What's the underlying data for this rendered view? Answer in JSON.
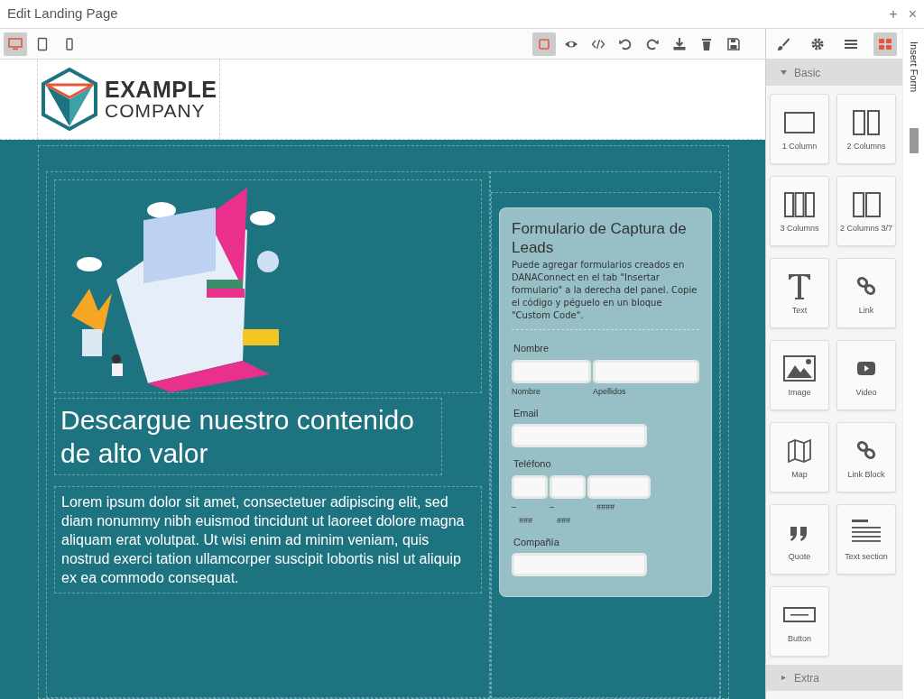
{
  "window": {
    "title": "Edit Landing Page",
    "add_button": "+",
    "close_button": "×"
  },
  "devices": [
    {
      "kind": "desktop",
      "selected": true
    },
    {
      "kind": "tablet",
      "selected": false
    },
    {
      "kind": "mobile",
      "selected": false
    }
  ],
  "actions": [
    {
      "kind": "outline",
      "selected": true
    },
    {
      "kind": "preview",
      "selected": false
    },
    {
      "kind": "code",
      "selected": false
    },
    {
      "kind": "undo",
      "selected": false
    },
    {
      "kind": "redo",
      "selected": false
    },
    {
      "kind": "import",
      "selected": false
    },
    {
      "kind": "delete",
      "selected": false
    },
    {
      "kind": "save",
      "selected": false
    }
  ],
  "panel_tabs": [
    {
      "kind": "style",
      "selected": false
    },
    {
      "kind": "settings",
      "selected": false
    },
    {
      "kind": "layers",
      "selected": false
    },
    {
      "kind": "blocks",
      "selected": true
    }
  ],
  "side_tab": {
    "label": "Insert Form"
  },
  "page": {
    "logo": {
      "line_1": "EXAMPLE",
      "line_2": "COMPANY"
    },
    "heading": "Descargue nuestro contenido de alto valor",
    "paragraph": "Lorem ipsum dolor sit amet, consectetuer adipiscing elit, sed diam nonummy nibh euismod tincidunt ut laoreet dolore magna aliquam erat volutpat. Ut wisi enim ad minim veniam, quis nostrud exerci tation ullamcorper suscipit lobortis nisl ut aliquip ex ea commodo consequat.",
    "form": {
      "title": "Formulario de Captura de Leads",
      "description": "Puede agregar formularios creados en DANAConnect en el tab \"Insertar formulario\" a la derecha del panel. Copie el código y péguelo en un bloque \"Custom Code\".",
      "fields": [
        {
          "kind": "name",
          "label": "Nombre",
          "inputs": [
            {
              "sublabel": "Nombre"
            },
            {
              "sublabel": "Apellidos"
            }
          ]
        },
        {
          "kind": "single",
          "label": "Email"
        },
        {
          "kind": "phone",
          "label": "Teléfono",
          "inputs": [
            {
              "separator": "–",
              "sublabel": "###"
            },
            {
              "separator": "–",
              "sublabel": "###"
            },
            {
              "sublabel": "####"
            }
          ]
        },
        {
          "kind": "single",
          "label": "Compañía"
        }
      ]
    }
  },
  "block_categories": [
    {
      "label": "Basic",
      "expanded": true,
      "blocks": [
        {
          "kind": "col1",
          "label": "1 Column"
        },
        {
          "kind": "col2",
          "label": "2 Columns"
        },
        {
          "kind": "col3",
          "label": "3 Columns"
        },
        {
          "kind": "col37",
          "label": "2 Columns 3/7"
        },
        {
          "kind": "text",
          "label": "Text"
        },
        {
          "kind": "link",
          "label": "Link"
        },
        {
          "kind": "image",
          "label": "Image"
        },
        {
          "kind": "video",
          "label": "Video"
        },
        {
          "kind": "map",
          "label": "Map"
        },
        {
          "kind": "link",
          "label": "Link Block"
        },
        {
          "kind": "quote",
          "label": "Quote"
        },
        {
          "kind": "textsection",
          "label": "Text section"
        },
        {
          "kind": "button",
          "label": "Button"
        }
      ]
    },
    {
      "label": "Extra",
      "expanded": false
    }
  ]
}
